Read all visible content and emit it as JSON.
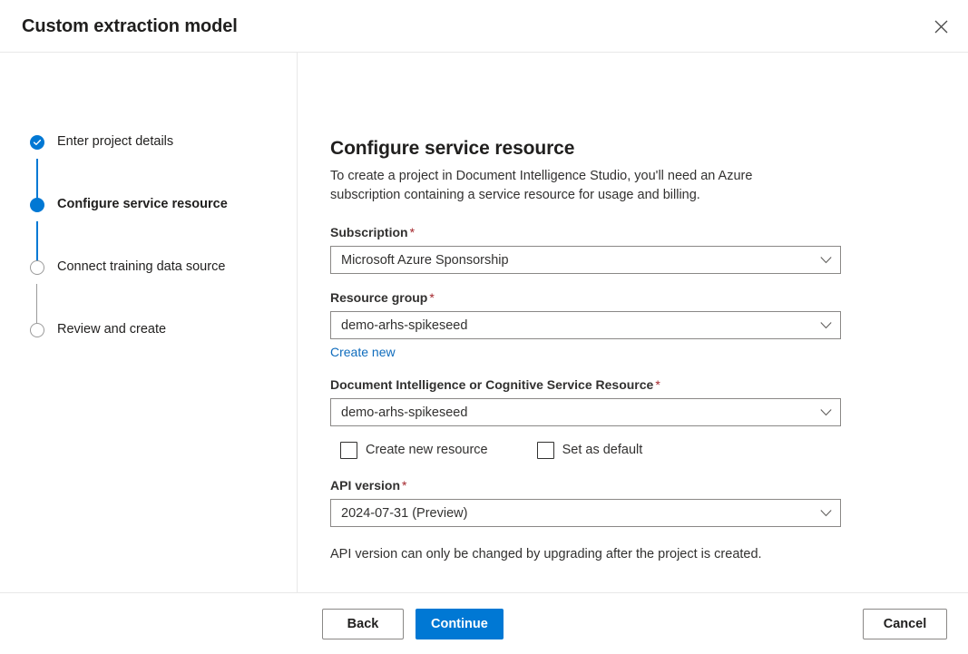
{
  "header": {
    "title": "Custom extraction model",
    "close_icon": "close-icon"
  },
  "stepper": {
    "steps": [
      {
        "label": "Enter project details",
        "state": "done"
      },
      {
        "label": "Configure service resource",
        "state": "current"
      },
      {
        "label": "Connect training data source",
        "state": "todo"
      },
      {
        "label": "Review and create",
        "state": "todo"
      }
    ]
  },
  "main": {
    "title": "Configure service resource",
    "description": "To create a project in Document Intelligence Studio, you'll need an Azure subscription containing a service resource for usage and billing.",
    "fields": {
      "subscription": {
        "label": "Subscription",
        "required": "*",
        "value": "Microsoft Azure Sponsorship",
        "chevron_icon": "chevron-down-icon"
      },
      "resource_group": {
        "label": "Resource group",
        "required": "*",
        "value": "demo-arhs-spikeseed",
        "chevron_icon": "chevron-down-icon",
        "create_new_label": "Create new"
      },
      "service_resource": {
        "label": "Document Intelligence or Cognitive Service Resource",
        "required": "*",
        "value": "demo-arhs-spikeseed",
        "chevron_icon": "chevron-down-icon"
      },
      "api_version": {
        "label": "API version",
        "required": "*",
        "value": "2024-07-31 (Preview)",
        "chevron_icon": "chevron-down-icon"
      }
    },
    "checkboxes": [
      {
        "label": "Create new resource",
        "checked": false
      },
      {
        "label": "Set as default",
        "checked": false
      }
    ],
    "note": "API version can only be changed by upgrading after the project is created."
  },
  "footer": {
    "back_label": "Back",
    "continue_label": "Continue",
    "cancel_label": "Cancel"
  },
  "colors": {
    "accent": "#0078d4",
    "link": "#0f6cbd",
    "required": "#a4262c",
    "border": "#8a8886",
    "divider": "#e8e8e8",
    "text": "#201f1e"
  }
}
